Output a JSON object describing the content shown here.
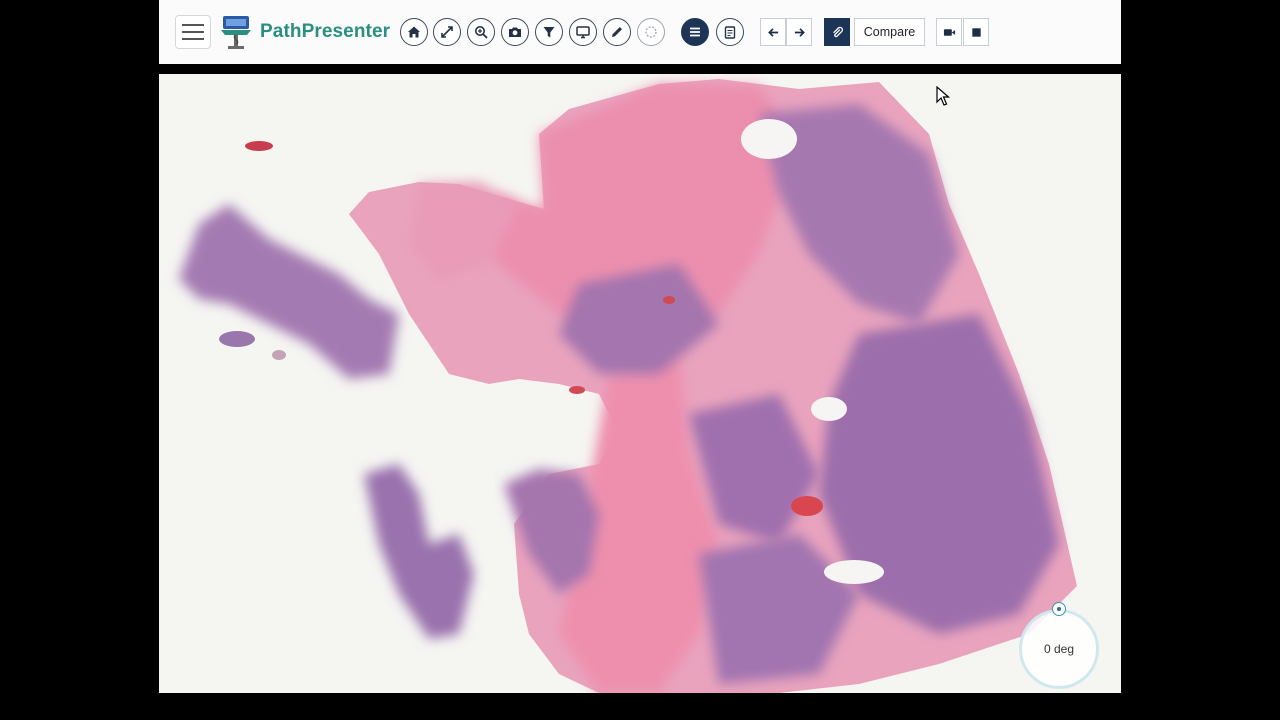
{
  "app": {
    "brand": "PathPresenter"
  },
  "toolbar": {
    "buttons": [
      {
        "name": "home",
        "icon": "home-icon"
      },
      {
        "name": "fullscreen",
        "icon": "expand-arrows-icon"
      },
      {
        "name": "zoom",
        "icon": "zoom-icon"
      },
      {
        "name": "snapshot",
        "icon": "camera-icon"
      },
      {
        "name": "filter",
        "icon": "filter-icon"
      },
      {
        "name": "present",
        "icon": "monitor-icon"
      },
      {
        "name": "annotate",
        "icon": "pencil-icon"
      },
      {
        "name": "rotate",
        "icon": "rotate-icon"
      },
      {
        "name": "list",
        "icon": "list-icon"
      },
      {
        "name": "report",
        "icon": "clipboard-icon"
      }
    ],
    "compare_label": "Compare"
  },
  "viewer": {
    "rotation_label": "0 deg",
    "rotation_degrees": 0
  },
  "colors": {
    "brand": "#2a8f7f",
    "toolbar_dark": "#1c3556",
    "tissue_pink": "#e48aa8",
    "tissue_purple": "#9a6fae"
  }
}
